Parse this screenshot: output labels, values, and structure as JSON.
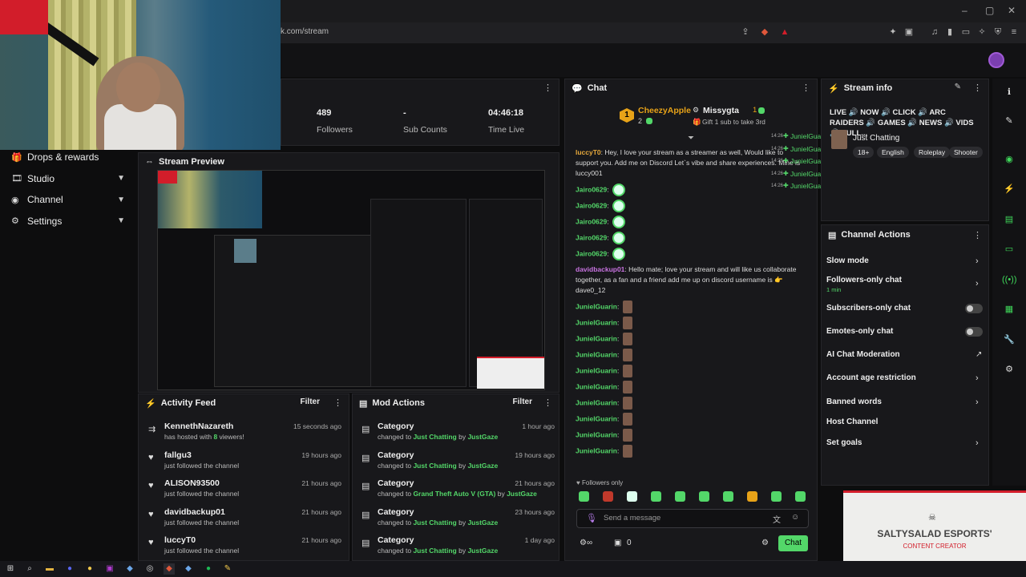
{
  "browser": {
    "url": "ck.com/stream",
    "window_controls": [
      "–",
      "▢",
      "✕"
    ]
  },
  "sidebar": {
    "items": [
      {
        "label": "Drops & rewards",
        "icon": "gift-icon",
        "chevron": false
      },
      {
        "label": "Studio",
        "icon": "video-icon",
        "chevron": true
      },
      {
        "label": "Channel",
        "icon": "channel-icon",
        "chevron": true
      },
      {
        "label": "Settings",
        "icon": "gear-icon",
        "chevron": true
      }
    ]
  },
  "stats": {
    "followers_value": "489",
    "followers_label": "Followers",
    "subs_value": "-",
    "subs_label": "Sub Counts",
    "time_value": "04:46:18",
    "time_label": "Time Live"
  },
  "preview": {
    "title": "Stream Preview"
  },
  "activity": {
    "title": "Activity Feed",
    "filter": "Filter",
    "items": [
      {
        "name": "KennethNazareth",
        "pre": "has hosted with ",
        "count": "8",
        "post": " viewers!",
        "time": "15 seconds ago",
        "icon": "host-icon"
      },
      {
        "name": "fallgu3",
        "desc": "just followed the channel",
        "time": "19 hours ago",
        "icon": "heart-icon"
      },
      {
        "name": "ALISON93500",
        "desc": "just followed the channel",
        "time": "21 hours ago",
        "icon": "heart-icon"
      },
      {
        "name": "davidbackup01",
        "desc": "just followed the channel",
        "time": "21 hours ago",
        "icon": "heart-icon"
      },
      {
        "name": "luccyT0",
        "desc": "just followed the channel",
        "time": "21 hours ago",
        "icon": "heart-icon"
      }
    ]
  },
  "mod": {
    "title": "Mod Actions",
    "filter": "Filter",
    "items": [
      {
        "title": "Category",
        "pre": "changed to ",
        "cat": "Just Chatting",
        "by": " by ",
        "user": "JustGaze",
        "time": "1 hour ago"
      },
      {
        "title": "Category",
        "pre": "changed to ",
        "cat": "Just Chatting",
        "by": " by ",
        "user": "JustGaze",
        "time": "19 hours ago"
      },
      {
        "title": "Category",
        "pre": "changed to ",
        "cat": "Grand Theft Auto V (GTA)",
        "by": " by ",
        "user": "JustGaze",
        "time": "21 hours ago"
      },
      {
        "title": "Category",
        "pre": "changed to ",
        "cat": "Just Chatting",
        "by": " by ",
        "user": "JustGaze",
        "time": "23 hours ago"
      },
      {
        "title": "Category",
        "pre": "changed to ",
        "cat": "Just Chatting",
        "by": " by ",
        "user": "JustGaze",
        "time": "1 day ago"
      }
    ]
  },
  "chat": {
    "title": "Chat",
    "top_gifter": {
      "rank": "1",
      "name": "CheezyApple",
      "count": "2"
    },
    "second": {
      "name": "Missygta",
      "count": "1",
      "note": "Gift 1 sub to take 3rd"
    },
    "messages": [
      {
        "user": "luccyT0",
        "color": "#e7a93c",
        "text": "Hey, I love your stream as a streamer as well, Would like to support you. Add me on Discord Let`s vibe and share experiences. Mine is luccy001"
      },
      {
        "user": "Jairo0629",
        "color": "#53d769",
        "text": ""
      },
      {
        "user": "Jairo0629",
        "color": "#53d769",
        "text": ""
      },
      {
        "user": "Jairo0629",
        "color": "#53d769",
        "text": ""
      },
      {
        "user": "Jairo0629",
        "color": "#53d769",
        "text": ""
      },
      {
        "user": "Jairo0629",
        "color": "#53d769",
        "text": ""
      },
      {
        "user": "davidbackup01",
        "color": "#c873e0",
        "text": "Hello mate; love your stream and will like us collaborate together, as a fan and a friend add me up on discord username is 👉 dave0_12"
      },
      {
        "user": "JunielGuarin",
        "color": "#53d769",
        "text": ""
      },
      {
        "user": "JunielGuarin",
        "color": "#53d769",
        "text": ""
      },
      {
        "user": "JunielGuarin",
        "color": "#53d769",
        "text": ""
      },
      {
        "user": "JunielGuarin",
        "color": "#53d769",
        "text": ""
      },
      {
        "user": "JunielGuarin",
        "color": "#53d769",
        "text": ""
      },
      {
        "user": "JunielGuarin",
        "color": "#53d769",
        "text": ""
      },
      {
        "user": "JunielGuarin",
        "color": "#53d769",
        "text": ""
      },
      {
        "user": "JunielGuarin",
        "color": "#53d769",
        "text": ""
      },
      {
        "user": "JunielGuarin",
        "color": "#53d769",
        "text": ""
      },
      {
        "user": "JunielGuarin",
        "color": "#53d769",
        "text": ""
      }
    ],
    "overlay": [
      {
        "time": "14:26",
        "user": "JunielGuarin"
      },
      {
        "time": "14:26",
        "user": "JunielGuarin"
      },
      {
        "time": "14:26",
        "user": "JunielGuarin"
      },
      {
        "time": "14:26",
        "user": "JunielGuarin"
      },
      {
        "time": "14:26",
        "user": "JunielGuarin"
      }
    ],
    "followers_only": "Followers only",
    "placeholder": "Send a message",
    "count": "0",
    "send": "Chat"
  },
  "stream_info": {
    "title": "Stream info",
    "stream_title": "LIVE 🔊 NOW 🔊 CLICK 🔊 ARC RAIDERS 🔊 GAMES 🔊 NEWS 🔊 VIDS 🔊 PULL...",
    "category": "Just Chatting",
    "tags": [
      "18+",
      "English",
      "Roleplay",
      "Shooter"
    ]
  },
  "channel_actions": {
    "title": "Channel Actions",
    "items": [
      {
        "label": "Slow mode",
        "type": "chevron"
      },
      {
        "label": "Followers-only chat",
        "sub": "1 min",
        "type": "chevron"
      },
      {
        "label": "Subscribers-only chat",
        "type": "toggle"
      },
      {
        "label": "Emotes-only chat",
        "type": "toggle"
      },
      {
        "label": "AI Chat Moderation",
        "type": "external"
      },
      {
        "label": "Account age restriction",
        "type": "chevron"
      },
      {
        "label": "Banned words",
        "type": "chevron"
      },
      {
        "label": "Host Channel",
        "type": "none"
      },
      {
        "label": "Set goals",
        "type": "chevron"
      }
    ]
  },
  "brand": {
    "name": "SALTYSALAD ESPORTS'",
    "tagline": "CONTENT CREATOR",
    "accent": "#d21d2a",
    "green": "#53d769"
  }
}
